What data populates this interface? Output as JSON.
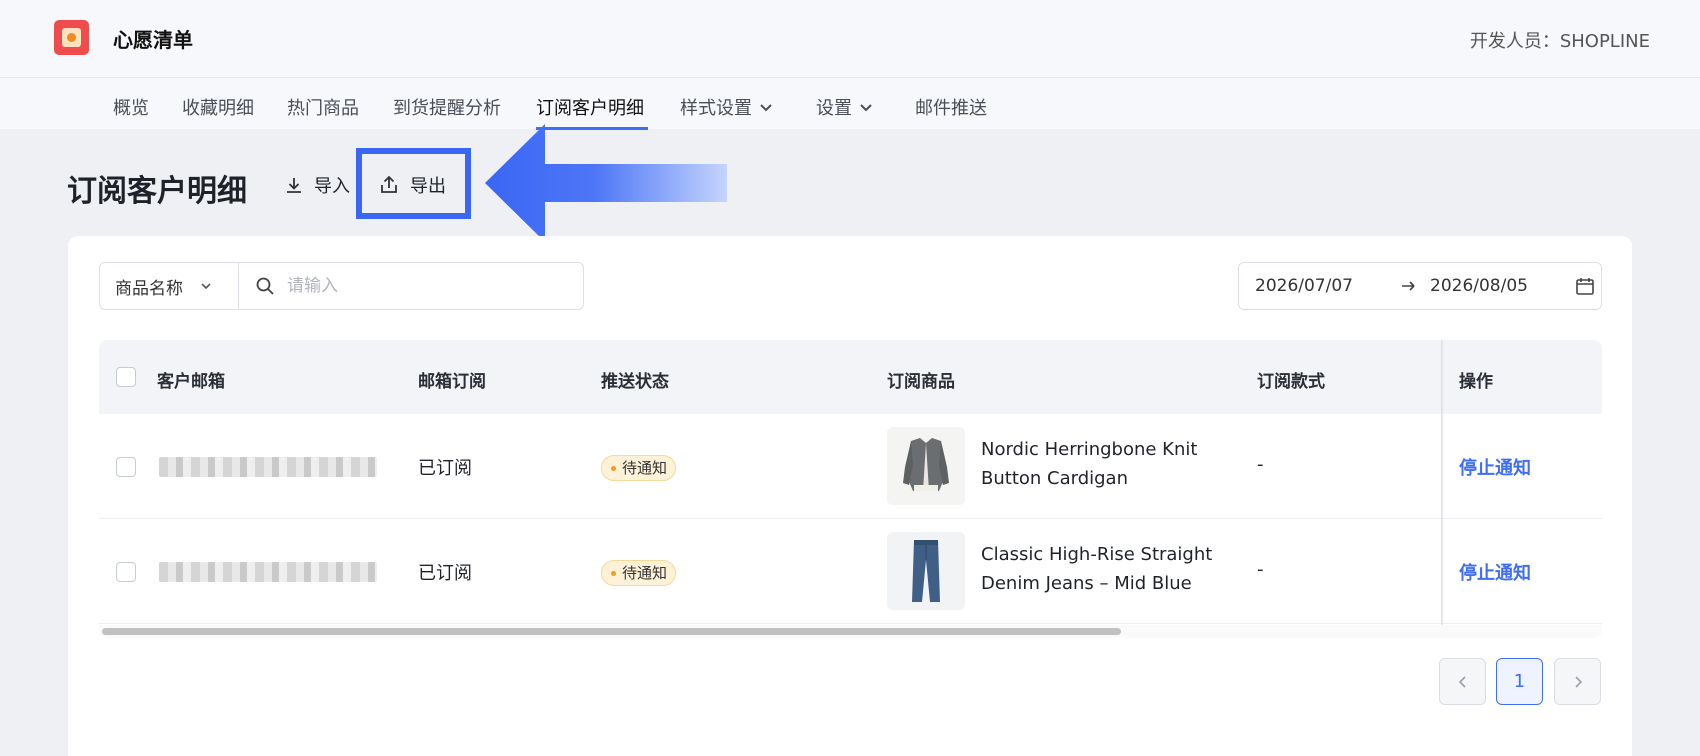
{
  "header": {
    "app_title": "心愿清单",
    "developer": "开发人员：SHOPLINE"
  },
  "nav": {
    "items": [
      {
        "label": "概览"
      },
      {
        "label": "收藏明细"
      },
      {
        "label": "热门商品"
      },
      {
        "label": "到货提醒分析"
      },
      {
        "label": "订阅客户明细",
        "active": true
      },
      {
        "label": "样式设置",
        "dropdown": true
      },
      {
        "label": "设置",
        "dropdown": true
      },
      {
        "label": "邮件推送"
      }
    ]
  },
  "page": {
    "title": "订阅客户明细",
    "import_label": "导入",
    "export_label": "导出"
  },
  "filters": {
    "field_select": "商品名称",
    "search_placeholder": "请输入",
    "date_start": "2026/07/07",
    "date_end": "2026/08/05"
  },
  "table": {
    "columns": [
      "客户邮箱",
      "邮箱订阅",
      "推送状态",
      "订阅商品",
      "订阅款式",
      "操作"
    ],
    "rows": [
      {
        "email": "",
        "subscription": "已订阅",
        "status": "待通知",
        "product_line1": "Nordic Herringbone Knit",
        "product_line2": "Button Cardigan",
        "variant": "-",
        "action": "停止通知"
      },
      {
        "email": "",
        "subscription": "已订阅",
        "status": "待通知",
        "product_line1": "Classic High-Rise Straight",
        "product_line2": "Denim Jeans – Mid Blue",
        "variant": "-",
        "action": "停止通知"
      }
    ]
  },
  "pagination": {
    "current_page": "1"
  },
  "colors": {
    "accent": "#3f6ef5",
    "highlight_arrow": "#3a66f5",
    "badge_bg": "#fdf1d8",
    "logo_red": "#ef4d4d"
  }
}
